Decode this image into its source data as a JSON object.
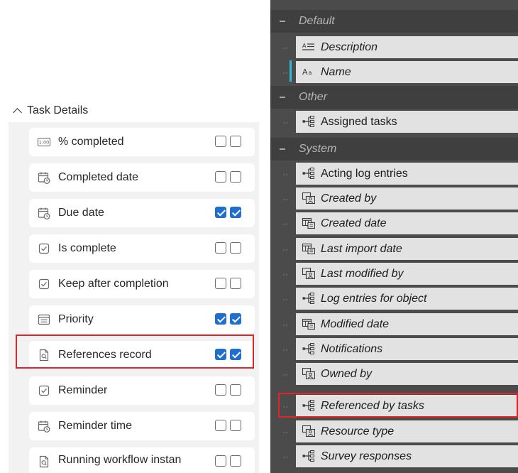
{
  "left_panel": {
    "section_title": "Task Details",
    "fields": [
      {
        "label": "% completed",
        "icon": "number-field-icon",
        "col1": false,
        "col2": false
      },
      {
        "label": "Completed date",
        "icon": "calendar-clock-icon",
        "col1": false,
        "col2": false
      },
      {
        "label": "Due date",
        "icon": "calendar-clock-icon",
        "col1": true,
        "col2": true
      },
      {
        "label": "Is complete",
        "icon": "checkbox-icon",
        "col1": false,
        "col2": false
      },
      {
        "label": "Keep after completion",
        "icon": "checkbox-icon",
        "col1": false,
        "col2": false
      },
      {
        "label": "Priority",
        "icon": "list-field-icon",
        "col1": true,
        "col2": true
      },
      {
        "label": "References record",
        "icon": "record-reference-icon",
        "col1": true,
        "col2": true
      },
      {
        "label": "Reminder",
        "icon": "checkbox-icon",
        "col1": false,
        "col2": false
      },
      {
        "label": "Reminder time",
        "icon": "calendar-clock-icon",
        "col1": false,
        "col2": false
      },
      {
        "label": "Running workflow instan",
        "icon": "record-reference-icon",
        "col1": false,
        "col2": false
      }
    ]
  },
  "right_panel": {
    "groups": [
      {
        "label": "Default",
        "items": [
          {
            "label": "Description",
            "icon": "text-lines-icon"
          },
          {
            "label": "Name",
            "icon": "text-aa-icon"
          }
        ]
      },
      {
        "label": "Other",
        "items": [
          {
            "label": "Assigned tasks",
            "icon": "relation-tree-icon"
          }
        ]
      },
      {
        "label": "System",
        "items": [
          {
            "label": "Acting log entries",
            "icon": "relation-tree-icon"
          },
          {
            "label": "Created by",
            "icon": "user-reference-icon"
          },
          {
            "label": "Created date",
            "icon": "calendar-grid-icon"
          },
          {
            "label": "Last import date",
            "icon": "calendar-grid-icon"
          },
          {
            "label": "Last modified by",
            "icon": "user-reference-icon"
          },
          {
            "label": "Log entries for object",
            "icon": "relation-tree-icon"
          },
          {
            "label": "Modified date",
            "icon": "calendar-grid-icon"
          },
          {
            "label": "Notifications",
            "icon": "relation-tree-icon"
          },
          {
            "label": "Owned by",
            "icon": "user-reference-icon"
          },
          {
            "label": "Referenced by tasks",
            "icon": "relation-tree-icon"
          },
          {
            "label": "Resource type",
            "icon": "user-reference-icon"
          },
          {
            "label": "Survey responses",
            "icon": "relation-tree-icon"
          }
        ]
      }
    ]
  },
  "colors": {
    "checkbox_checked": "#1f6fd1",
    "highlight_border": "#e0242a",
    "selected_row_indicator": "#2bbcd8",
    "dark_panel_bg": "#4b4b4b"
  }
}
